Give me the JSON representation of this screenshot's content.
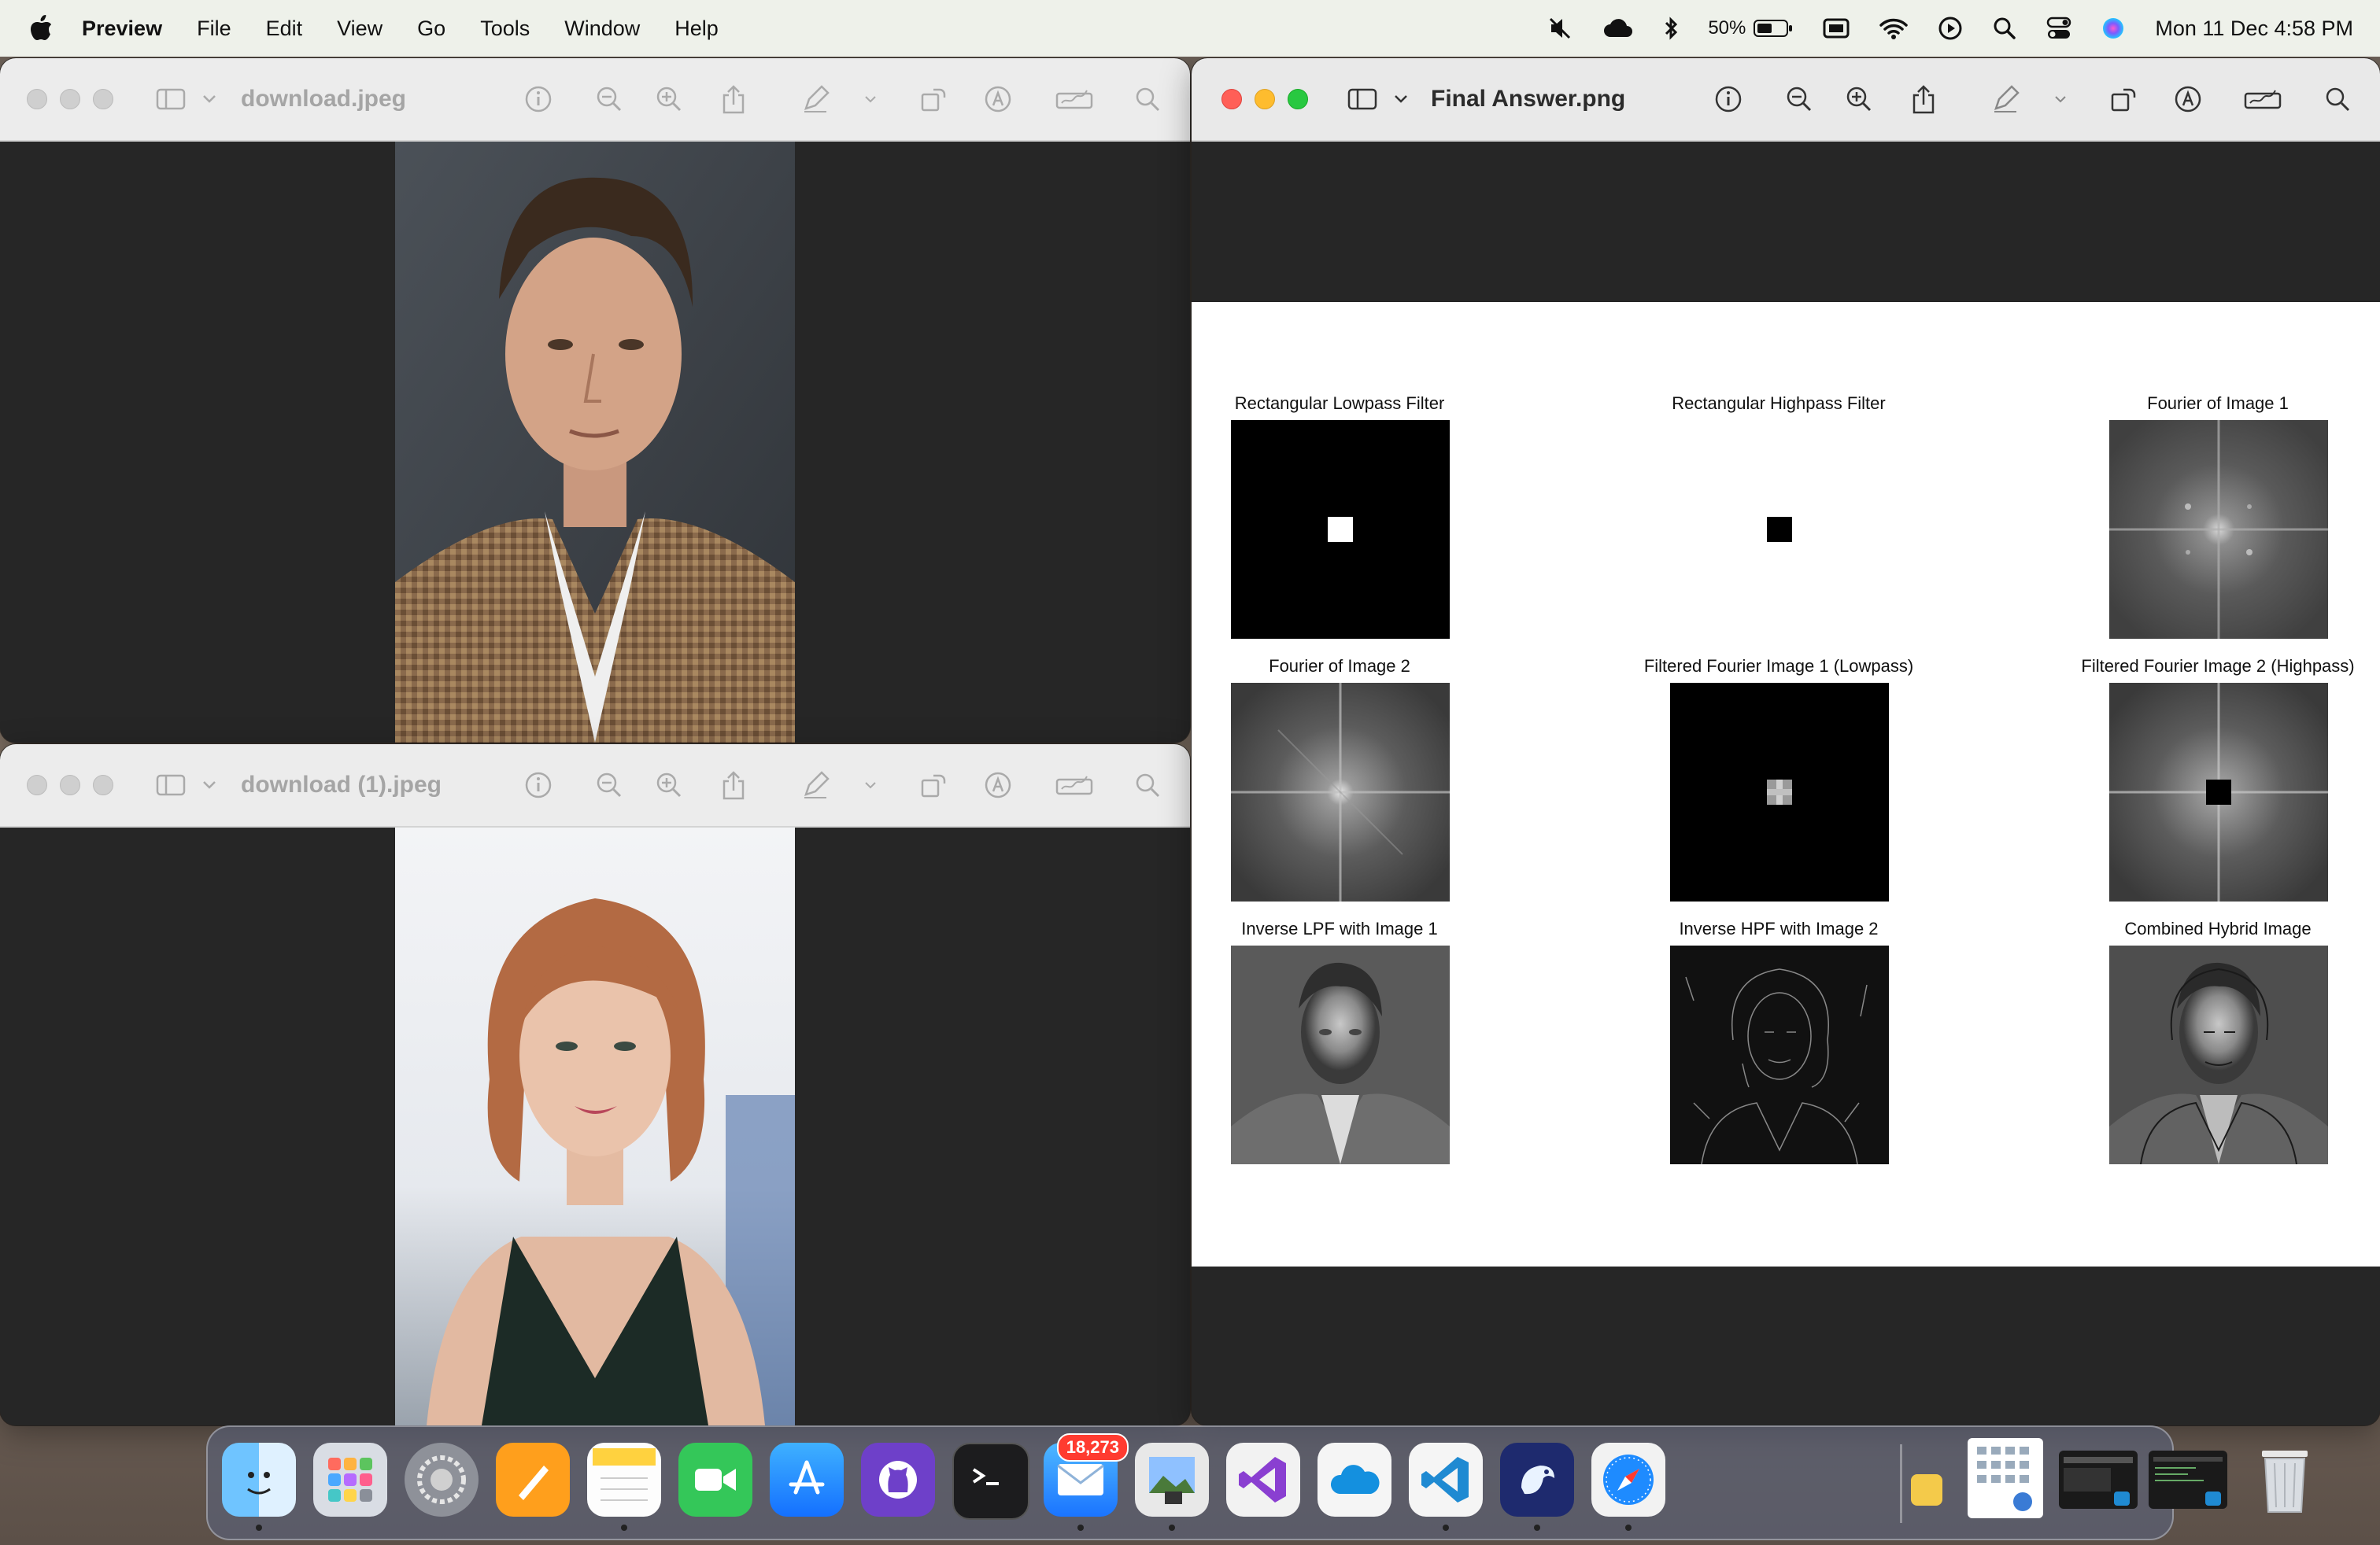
{
  "menubar": {
    "app_name": "Preview",
    "items": [
      "File",
      "Edit",
      "View",
      "Go",
      "Tools",
      "Window",
      "Help"
    ],
    "battery": "50%",
    "datetime": "Mon 11 Dec  4:58 PM"
  },
  "windows": {
    "top_left": {
      "title": "download.jpeg"
    },
    "bottom_left": {
      "title": "download (1).jpeg"
    },
    "right": {
      "title": "Final Answer.png"
    }
  },
  "figure": {
    "panels": [
      {
        "title": "Rectangular Lowpass Filter"
      },
      {
        "title": "Rectangular Highpass Filter"
      },
      {
        "title": "Fourier of Image 1"
      },
      {
        "title": "Fourier of Image 2"
      },
      {
        "title": "Filtered Fourier Image 1 (Lowpass)"
      },
      {
        "title": "Filtered Fourier Image 2 (Highpass)"
      },
      {
        "title": "Inverse LPF with Image 1"
      },
      {
        "title": "Inverse HPF with Image 2"
      },
      {
        "title": "Combined Hybrid Image"
      }
    ]
  },
  "dock": {
    "mail_badge": "18,273",
    "apps": [
      "finder",
      "launchpad",
      "system-settings",
      "pages",
      "notes",
      "facetime",
      "app-store",
      "github-desktop",
      "terminal",
      "mail",
      "preview",
      "visual-studio",
      "onedrive",
      "vscode",
      "cyberduck",
      "safari"
    ]
  }
}
